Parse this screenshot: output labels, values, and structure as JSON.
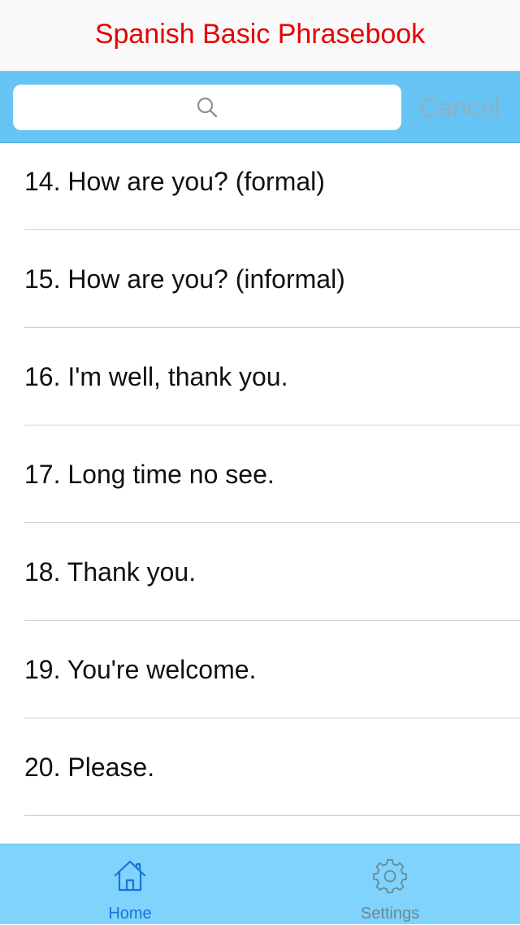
{
  "app": {
    "title": "Spanish Basic Phrasebook",
    "title_color": "#e60000"
  },
  "search": {
    "placeholder": "",
    "value": "",
    "cancel_label": "Cancel",
    "bar_color": "#66c4f5"
  },
  "phrases": [
    "14. How are you? (formal)",
    "15. How are you? (informal)",
    "16. I'm well, thank you.",
    "17. Long time no see.",
    "18. Thank you.",
    "19. You're welcome.",
    "20. Please."
  ],
  "tabs": [
    {
      "label": "Home",
      "icon": "home-icon",
      "selected": true,
      "color": "#1a73d9"
    },
    {
      "label": "Settings",
      "icon": "gear-icon",
      "selected": false,
      "color": "#6b8795"
    }
  ],
  "tab_bar_color": "#7fd3fc"
}
